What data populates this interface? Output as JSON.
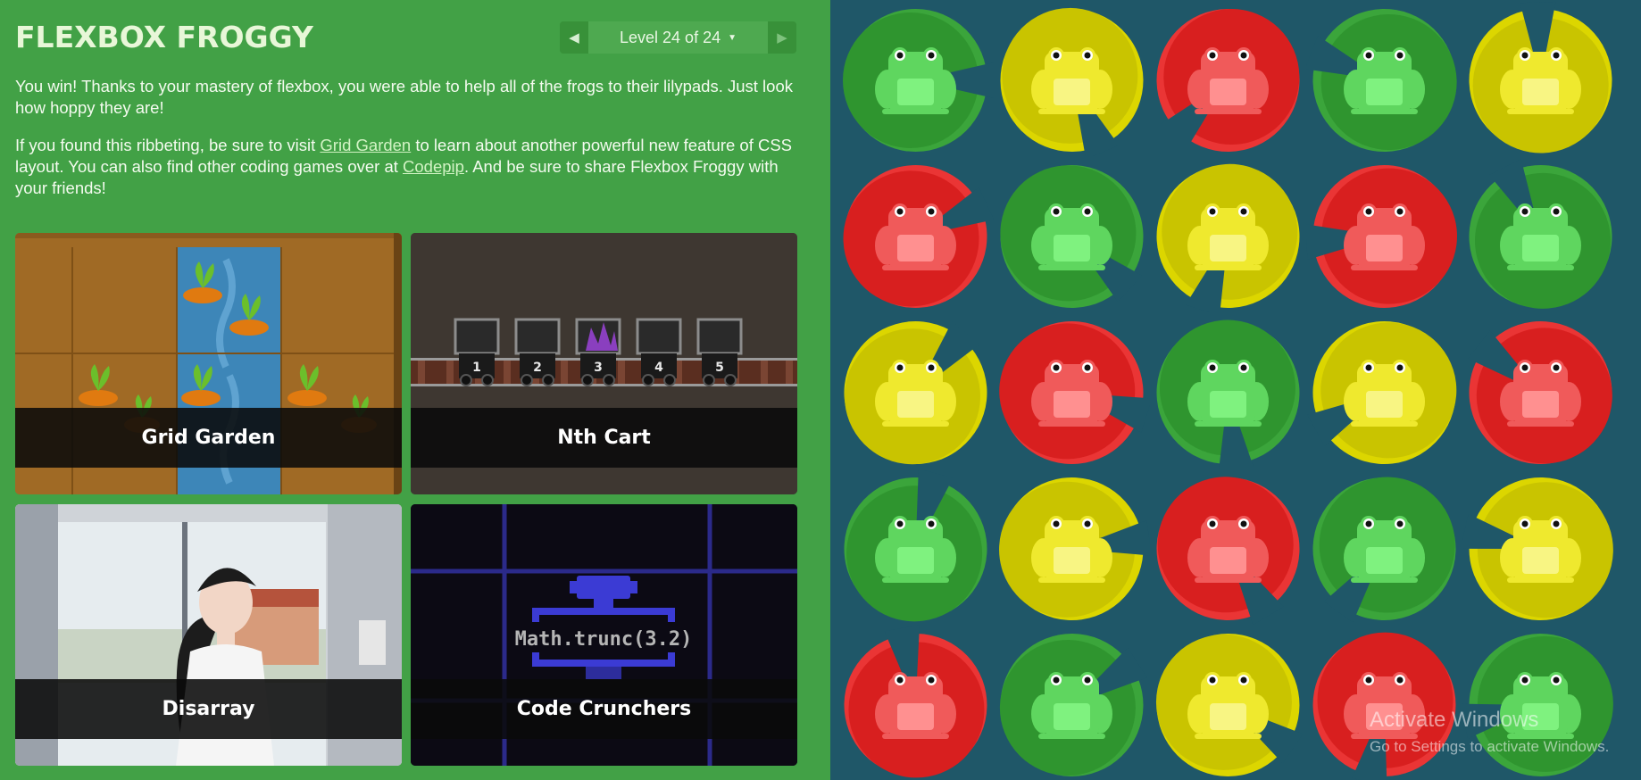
{
  "header": {
    "title": "FLEXBOX FROGGY",
    "level_label": "Level 24 of 24",
    "prev_arrow": "◀",
    "next_arrow": "▶",
    "caret": "▼"
  },
  "intro": {
    "win_text": "You win! Thanks to your mastery of flexbox, you were able to help all of the frogs to their lilypads. Just look how hoppy they are!",
    "p2_before": "If you found this ribbeting, be sure to visit ",
    "grid_garden_link": "Grid Garden",
    "p2_middle": " to learn about another powerful new feature of CSS layout. You can also find other coding games over at ",
    "codepip_link": "Codepip",
    "p2_after": ". And be sure to share Flexbox Froggy with your friends!"
  },
  "games": [
    {
      "name": "Grid Garden"
    },
    {
      "name": "Nth Cart"
    },
    {
      "name": "Disarray"
    },
    {
      "name": "Code Crunchers"
    }
  ],
  "cards_text": {
    "cart_numbers": [
      "1",
      "2",
      "3",
      "4",
      "5"
    ],
    "code_snippet": "Math.trunc(3.2)"
  },
  "pond": {
    "rows": [
      [
        "green",
        "yellow",
        "red",
        "green",
        "yellow"
      ],
      [
        "red",
        "green",
        "yellow",
        "red",
        "green"
      ],
      [
        "yellow",
        "red",
        "green",
        "yellow",
        "red"
      ],
      [
        "green",
        "yellow",
        "red",
        "green",
        "yellow"
      ],
      [
        "red",
        "green",
        "yellow",
        "red",
        "green"
      ]
    ],
    "colors": {
      "green": {
        "pad": "#2f952f",
        "pad_dark": "#3ba53b",
        "frog": "#5fd65f",
        "belly": "#7ff27f"
      },
      "yellow": {
        "pad": "#c9c400",
        "pad_dark": "#dcd600",
        "frog": "#efe92e",
        "belly": "#f8f583"
      },
      "red": {
        "pad": "#d81f1f",
        "pad_dark": "#ea3535",
        "frog": "#f05a5a",
        "belly": "#ff9090"
      }
    }
  },
  "watermark": {
    "line1": "Activate Windows",
    "line2": "Go to Settings to activate Windows."
  }
}
